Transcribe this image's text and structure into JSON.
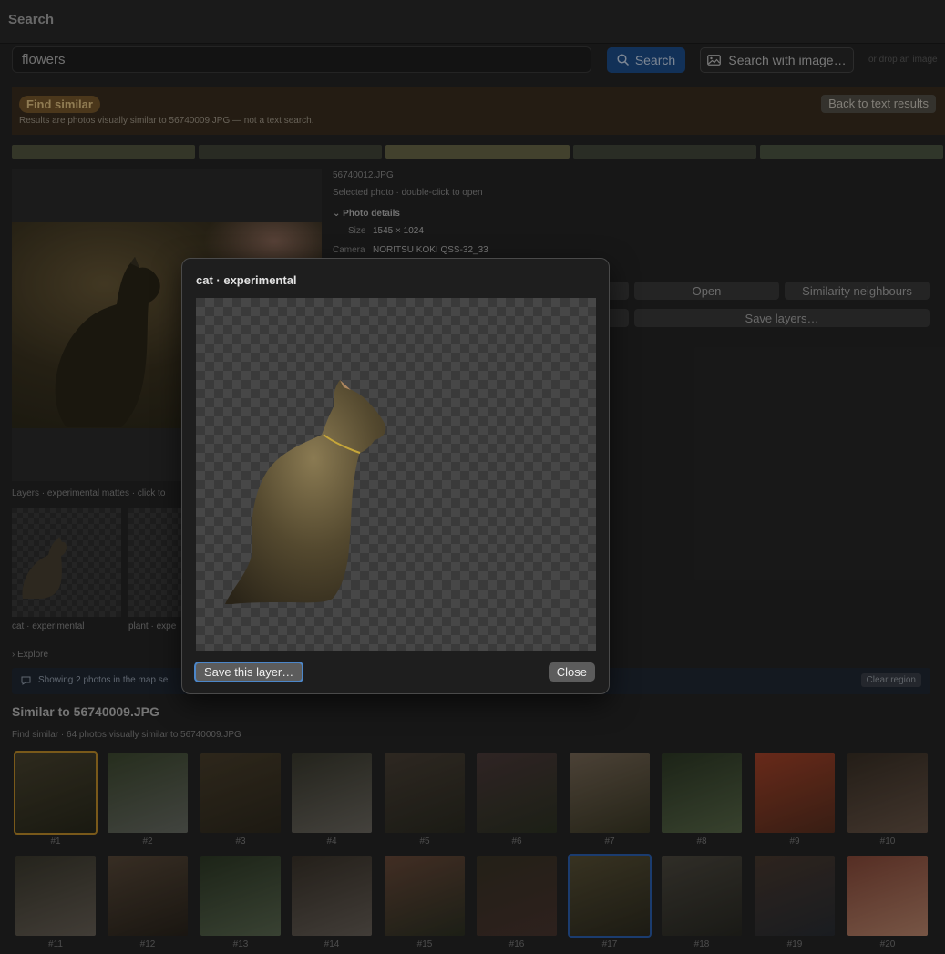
{
  "window": {
    "title": "Search"
  },
  "search": {
    "value": "flowers",
    "button_label": "Search",
    "image_button_label": "Search with image…",
    "drop_hint": "or drop an image"
  },
  "banner": {
    "pill": "Find similar",
    "description": "Results are photos visually similar to 56740009.JPG — not a text search.",
    "back_label": "Back to text results"
  },
  "swatches": [
    "#555841",
    "#434639",
    "#6b6a4a",
    "#454a3c",
    "#4e5845"
  ],
  "selected": {
    "filename": "56740012.JPG",
    "hint": "Selected photo · double-click to open",
    "details_heading": "Photo details",
    "size_label": "Size",
    "size_value": "1545 × 1024",
    "camera_label": "Camera",
    "camera_value": "NORITSU KOKI QSS-32_33"
  },
  "actions": {
    "open": "Open",
    "similarity": "Similarity neighbours",
    "save_layers": "Save layers…"
  },
  "layers": {
    "label": "Layers · experimental mattes · click to",
    "items": [
      {
        "caption": "cat · experimental"
      },
      {
        "caption": "plant · expe"
      }
    ]
  },
  "explore": {
    "label": "Explore"
  },
  "map_bar": {
    "text": "Showing 2 photos in the map sel",
    "clear_label": "Clear region"
  },
  "similar": {
    "heading": "Similar to 56740009.JPG",
    "subtitle": "Find similar · 64 photos visually similar to 56740009.JPG",
    "tiles": [
      {
        "label": "#1",
        "c1": "#4a4430",
        "c2": "#2a2a1c"
      },
      {
        "label": "#2",
        "c1": "#3e4a30",
        "c2": "#6a6e66"
      },
      {
        "label": "#3",
        "c1": "#4a3f2c",
        "c2": "#2f2a1e"
      },
      {
        "label": "#4",
        "c1": "#3a3a2e",
        "c2": "#6e6a62"
      },
      {
        "label": "#5",
        "c1": "#4a4036",
        "c2": "#2c2c22"
      },
      {
        "label": "#6",
        "c1": "#4c3a3a",
        "c2": "#2e3424"
      },
      {
        "label": "#7",
        "c1": "#7a6a58",
        "c2": "#3c3a26"
      },
      {
        "label": "#8",
        "c1": "#2e3a26",
        "c2": "#5a6a4a"
      },
      {
        "label": "#9",
        "c1": "#a8442a",
        "c2": "#5a3020"
      },
      {
        "label": "#10",
        "c1": "#3a3026",
        "c2": "#6a5648"
      },
      {
        "label": "#11",
        "c1": "#3c3a2e",
        "c2": "#6a6258"
      },
      {
        "label": "#12",
        "c1": "#5a4a3a",
        "c2": "#2a241c"
      },
      {
        "label": "#13",
        "c1": "#2e3a26",
        "c2": "#5c6a52"
      },
      {
        "label": "#14",
        "c1": "#3a332a",
        "c2": "#6a625a"
      },
      {
        "label": "#15",
        "c1": "#6a4a3a",
        "c2": "#2e3224"
      },
      {
        "label": "#16",
        "c1": "#3a3426",
        "c2": "#4a3630"
      },
      {
        "label": "#17",
        "c1": "#5a5236",
        "c2": "#2e2c20"
      },
      {
        "label": "#18",
        "c1": "#4e4a40",
        "c2": "#2a2a24"
      },
      {
        "label": "#19",
        "c1": "#4a3a30",
        "c2": "#2a2e34"
      },
      {
        "label": "#20",
        "c1": "#8a4a3a",
        "c2": "#c08a70"
      }
    ]
  },
  "dialog": {
    "title": "cat · experimental",
    "save_label": "Save this layer…",
    "close_label": "Close"
  }
}
